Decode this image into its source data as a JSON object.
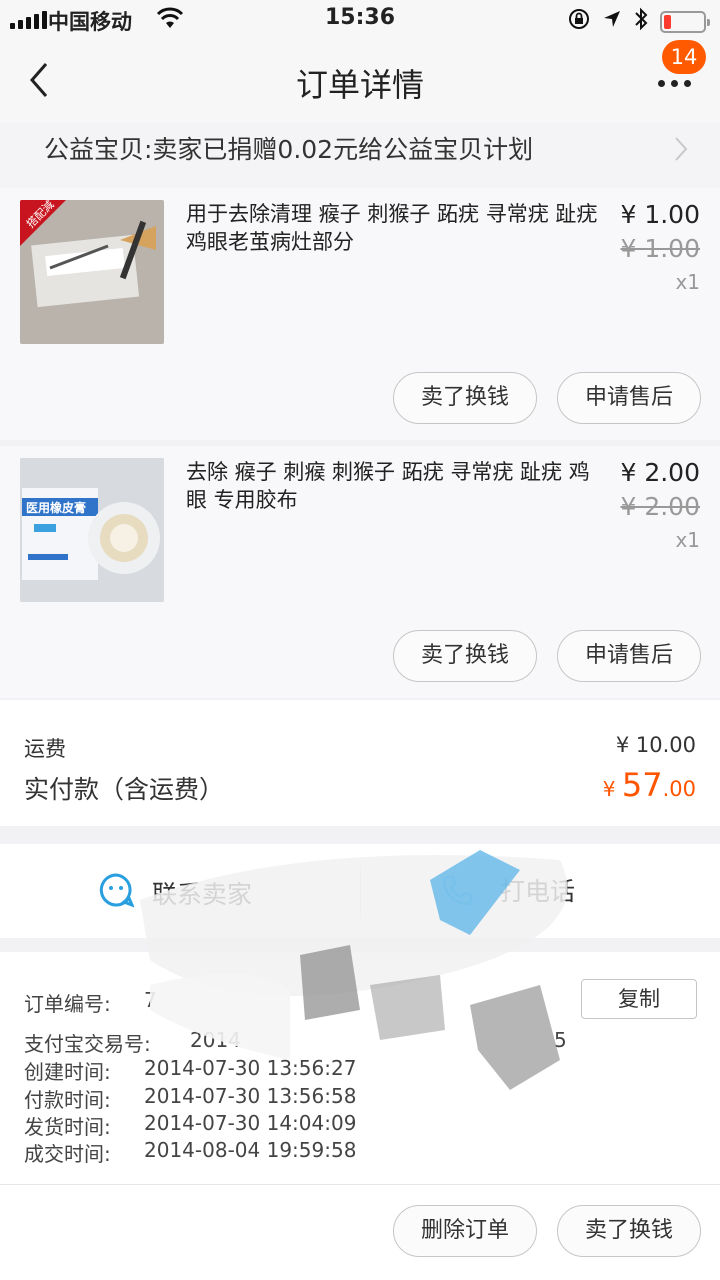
{
  "status_bar": {
    "carrier": "中国移动",
    "time": "15:36"
  },
  "nav": {
    "title": "订单详情",
    "badge": "14"
  },
  "charity": {
    "text": "公益宝贝:卖家已捐赠0.02元给公益宝贝计划"
  },
  "items": [
    {
      "name": "用于去除清理 瘊子 刺猴子 跖疣 寻常疣 趾疣 鸡眼老茧病灶部分",
      "price": "¥ 1.00",
      "original_price": "¥ 1.00",
      "quantity": "x1",
      "tag": "搭配減",
      "btn_sell": "卖了换钱",
      "btn_after_sale": "申请售后"
    },
    {
      "name": "去除 瘊子 刺瘊 刺猴子 跖疣 寻常疣 趾疣 鸡眼 专用胶布",
      "price": "¥ 2.00",
      "original_price": "¥ 2.00",
      "quantity": "x1",
      "box_text": "医用橡皮膏",
      "btn_sell": "卖了换钱",
      "btn_after_sale": "申请售后"
    }
  ],
  "totals": {
    "shipping_label": "运费",
    "shipping_value": "¥ 10.00",
    "paid_label": "实付款（含运费）",
    "paid_currency": "¥ ",
    "paid_integer": "57",
    "paid_decimal": ".00"
  },
  "contact": {
    "seller": "联系卖家",
    "call": "打电话"
  },
  "order_info": {
    "order_no_label": "订单编号:",
    "order_no_value": "7",
    "copy": "复制",
    "alipay_label": "支付宝交易号:",
    "alipay_value": "2014",
    "alipay_tail": "5",
    "created_label": "创建时间:",
    "created_value": "2014-07-30 13:56:27",
    "paid_label": "付款时间:",
    "paid_value": "2014-07-30 13:56:58",
    "shipped_label": "发货时间:",
    "shipped_value": "2014-07-30 14:04:09",
    "completed_label": "成交时间:",
    "completed_value": "2014-08-04 19:59:58"
  },
  "bottom": {
    "delete": "删除订单",
    "sell": "卖了换钱"
  },
  "colors": {
    "accent": "#ff5500",
    "badge": "#ff5a00",
    "scribble_blue": "#5ab4e8"
  }
}
